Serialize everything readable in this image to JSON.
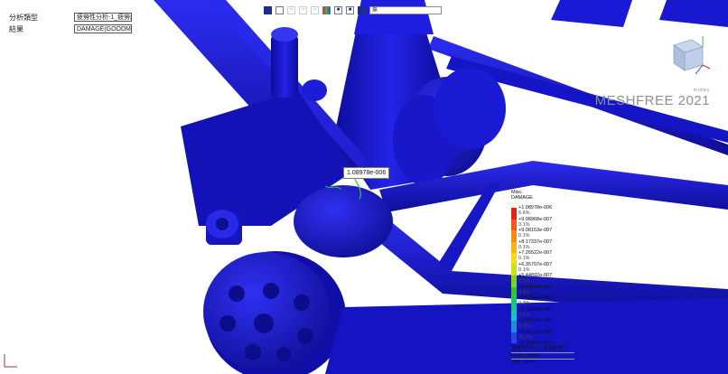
{
  "info": {
    "analysis_type_label": "分析類型",
    "analysis_type_value": "疲勞性分析-1_疲勞結果-1",
    "result_label": "結果",
    "result_value": "DAMAGE(GOODMAN)"
  },
  "toolbar": {
    "icons": [
      "frame-icon",
      "box-icon",
      "view-icon",
      "view-icon",
      "view-icon",
      "palette-icon",
      "sheet-icon",
      "sheet-icon",
      "cube-view-icon"
    ],
    "search_value": "無"
  },
  "brand": {
    "small": "midas",
    "big": "MESHFREE 2021"
  },
  "probe": {
    "value": "1.08978e-006"
  },
  "legend": {
    "title": "Misc.",
    "subtitle": "DAMAGE",
    "ticks": [
      "+1.08978e-006",
      "+9.98968e-007",
      "+9.08153e-007",
      "+8.17337e-007",
      "+7.26522e-007",
      "+6.35707e-007",
      "+5.44892e-007",
      "+4.54076e-007",
      "+3.63261e-007",
      "+2.72446e-007",
      "+1.81631e-007",
      "+9.08153e-008",
      "+0.00000e+000"
    ],
    "percents": [
      "6.6%",
      "0.1%",
      "0.1%",
      "0.1%",
      "0.1%",
      "0.1%",
      "0.2%",
      "0.2%",
      "0.3%",
      "0.2%",
      "0.3%",
      "91.7%"
    ],
    "colors": [
      "#e0231b",
      "#ef5a18",
      "#f68c15",
      "#f6b416",
      "#f2dc1b",
      "#c6e21c",
      "#7ad623",
      "#2dc83a",
      "#17c48c",
      "#18c0c6",
      "#1a8ddb",
      "#2348e0"
    ],
    "footer": [
      "疲勞性分析-1_疲勞結果-1",
      "Linear Static",
      "Unit : None"
    ]
  },
  "colors": {
    "model": "#1c1ce4",
    "background": "#ffffff",
    "accent_red": "#e0231b",
    "accent_green": "#2dc83a"
  }
}
